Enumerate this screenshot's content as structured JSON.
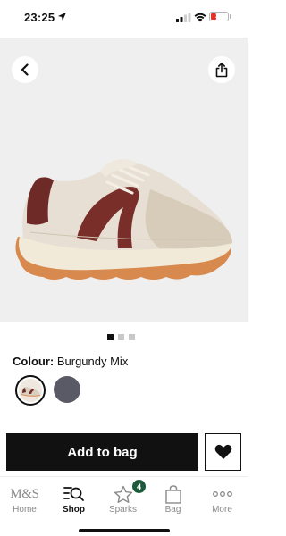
{
  "status_bar": {
    "time": "23:25",
    "battery_level": "20",
    "icons": [
      "location-arrow-icon",
      "signal-icon",
      "wifi-icon",
      "battery-icon"
    ]
  },
  "product": {
    "image_count": 3,
    "active_image": 1,
    "colour_label": "Colour:",
    "colour_value": "Burgundy Mix",
    "swatches": [
      {
        "name": "Burgundy Mix",
        "selected": true,
        "color": "#7a2e2a"
      },
      {
        "name": "Grey",
        "selected": false,
        "color": "#5a5966"
      }
    ]
  },
  "actions": {
    "add_to_bag_label": "Add to bag",
    "back_icon": "chevron-left-icon",
    "share_icon": "share-icon",
    "favourite_icon": "heart-icon"
  },
  "tab_bar": {
    "tabs": [
      {
        "label": "Home",
        "icon": "ms-logo"
      },
      {
        "label": "Shop",
        "icon": "search-list-icon",
        "active": true
      },
      {
        "label": "Sparks",
        "icon": "star-icon",
        "badge": "4"
      },
      {
        "label": "Bag",
        "icon": "bag-icon"
      },
      {
        "label": "More",
        "icon": "more-dots-icon"
      }
    ],
    "home_logo_text": "M&S"
  },
  "colors": {
    "accent": "#111111",
    "badge_green": "#1c5a3c",
    "image_background": "#efefef"
  }
}
